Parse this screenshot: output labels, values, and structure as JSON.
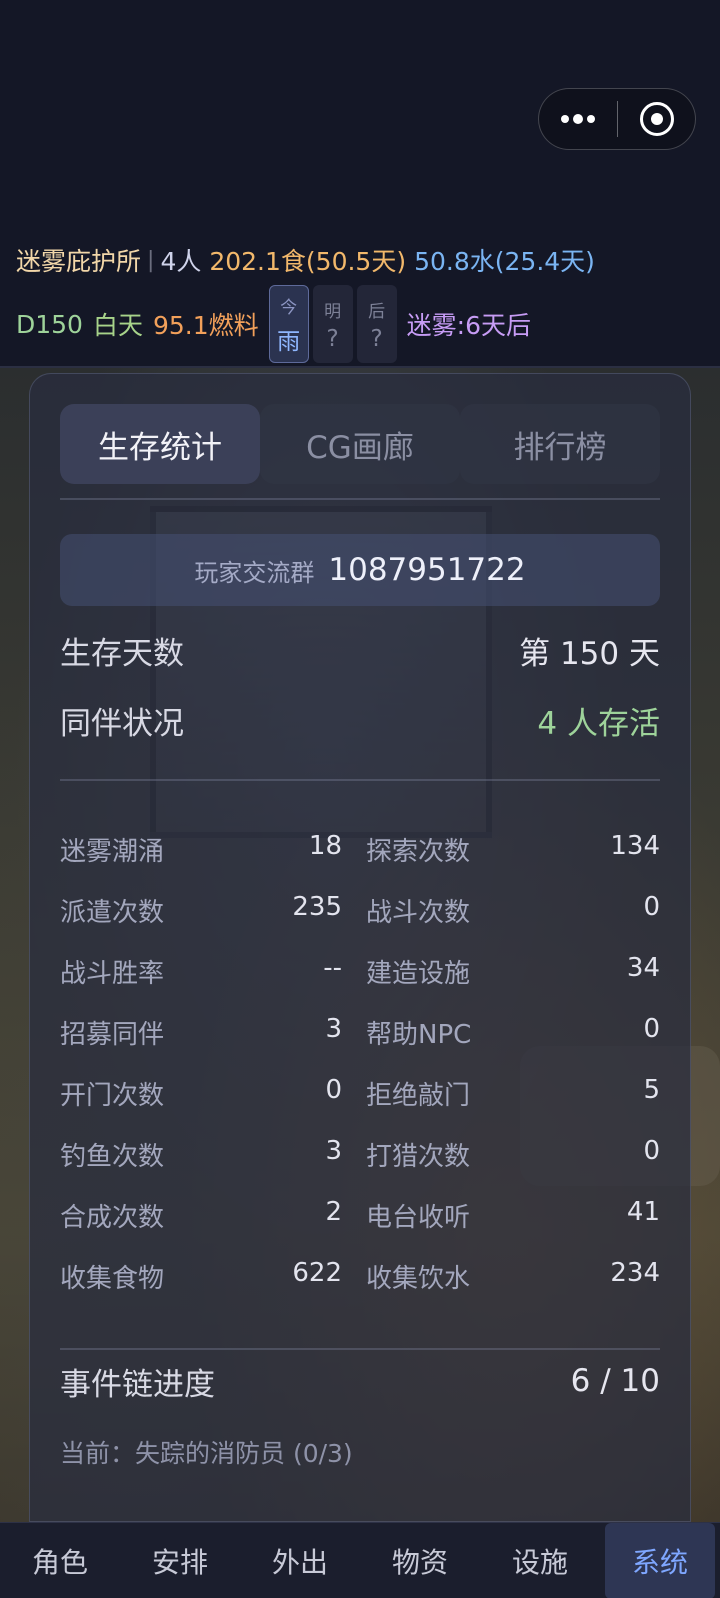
{
  "capsule": {
    "more_icon": "more-dots-icon",
    "close_icon": "target-circle-icon"
  },
  "status": {
    "shelter_name": "迷雾庇护所",
    "separator": "|",
    "people": "4人",
    "food": "202.1食(50.5天)",
    "water": "50.8水(25.4天)",
    "day": "D150",
    "time_of_day": "白天",
    "fuel": "95.1燃料",
    "weather": [
      {
        "label": "今",
        "value": "雨"
      },
      {
        "label": "明",
        "value": "?"
      },
      {
        "label": "后",
        "value": "?"
      }
    ],
    "fog": "迷雾:6天后"
  },
  "tabs": [
    {
      "label": "生存统计",
      "active": true
    },
    {
      "label": "CG画廊",
      "active": false
    },
    {
      "label": "排行榜",
      "active": false
    }
  ],
  "group": {
    "label": "玩家交流群",
    "number": "1087951722"
  },
  "summary": {
    "days_label": "生存天数",
    "days_value": "第 150 天",
    "companions_label": "同伴状况",
    "companions_value": "4 人存活"
  },
  "stats": [
    [
      {
        "k": "迷雾潮涌",
        "v": "18"
      },
      {
        "k": "探索次数",
        "v": "134"
      }
    ],
    [
      {
        "k": "派遣次数",
        "v": "235"
      },
      {
        "k": "战斗次数",
        "v": "0"
      }
    ],
    [
      {
        "k": "战斗胜率",
        "v": "--"
      },
      {
        "k": "建造设施",
        "v": "34"
      }
    ],
    [
      {
        "k": "招募同伴",
        "v": "3"
      },
      {
        "k": "帮助NPC",
        "v": "0"
      }
    ],
    [
      {
        "k": "开门次数",
        "v": "0"
      },
      {
        "k": "拒绝敲门",
        "v": "5"
      }
    ],
    [
      {
        "k": "钓鱼次数",
        "v": "3"
      },
      {
        "k": "打猎次数",
        "v": "0"
      }
    ],
    [
      {
        "k": "合成次数",
        "v": "2"
      },
      {
        "k": "电台收听",
        "v": "41"
      }
    ],
    [
      {
        "k": "收集食物",
        "v": "622"
      },
      {
        "k": "收集饮水",
        "v": "234"
      }
    ]
  ],
  "chain": {
    "label": "事件链进度",
    "value": "6 / 10",
    "current": "当前：失踪的消防员 (0/3)"
  },
  "nav": [
    {
      "label": "角色",
      "active": false
    },
    {
      "label": "安排",
      "active": false
    },
    {
      "label": "外出",
      "active": false
    },
    {
      "label": "物资",
      "active": false
    },
    {
      "label": "设施",
      "active": false
    },
    {
      "label": "系统",
      "active": true
    }
  ]
}
